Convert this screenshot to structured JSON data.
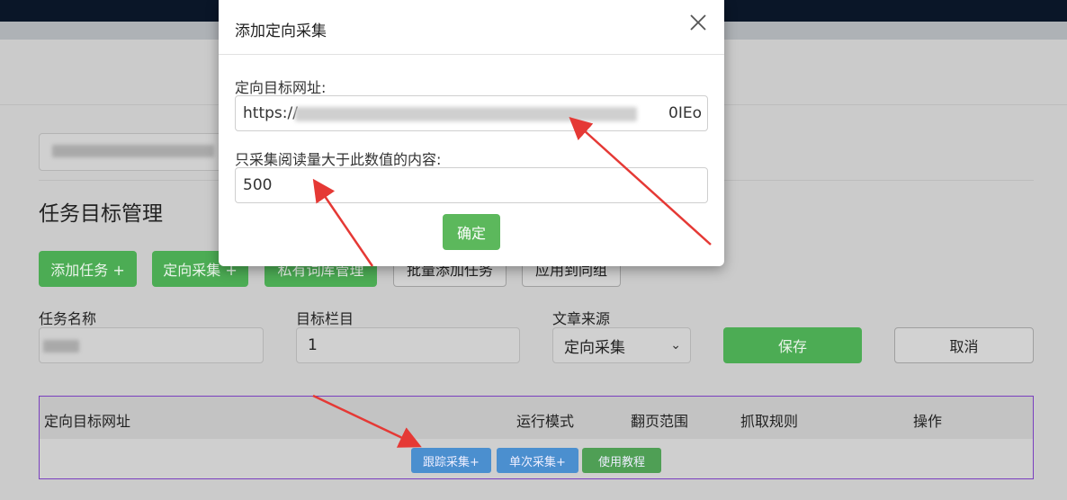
{
  "nav": {
    "left_items": [
      "任务目标管理",
      "任务目标管理"
    ],
    "right_text": ""
  },
  "page": {
    "section_title": "任务目标管理",
    "toolbar": {
      "add_task": "添加任务 +",
      "directed_collect": "定向采集 +",
      "private_lib": "私有词库管理",
      "batch_add": "批量添加任务",
      "apply_group": "应用到同组"
    },
    "form": {
      "task_name_label": "任务名称",
      "task_name_value": "",
      "target_column_label": "目标栏目",
      "target_column_value": "1",
      "source_label": "文章来源",
      "source_value": "定向采集",
      "save": "保存",
      "cancel": "取消"
    },
    "table": {
      "headers": [
        "定向目标网址",
        "运行模式",
        "翻页范围",
        "抓取规则",
        "操作"
      ],
      "buttons": {
        "track": "跟踪采集+",
        "single": "单次采集+",
        "tutorial": "使用教程"
      }
    }
  },
  "modal": {
    "title": "添加定向采集",
    "url_label": "定向目标网址:",
    "url_value": "https://",
    "url_tail": "0IEo",
    "threshold_label": "只采集阅读量大于此数值的内容:",
    "threshold_value": "500",
    "confirm": "确定"
  },
  "colors": {
    "accent_green": "#5cb85c",
    "accent_blue": "#4b8fcf",
    "annotation_red": "#e53935",
    "nav_bg": "#0a1628"
  }
}
